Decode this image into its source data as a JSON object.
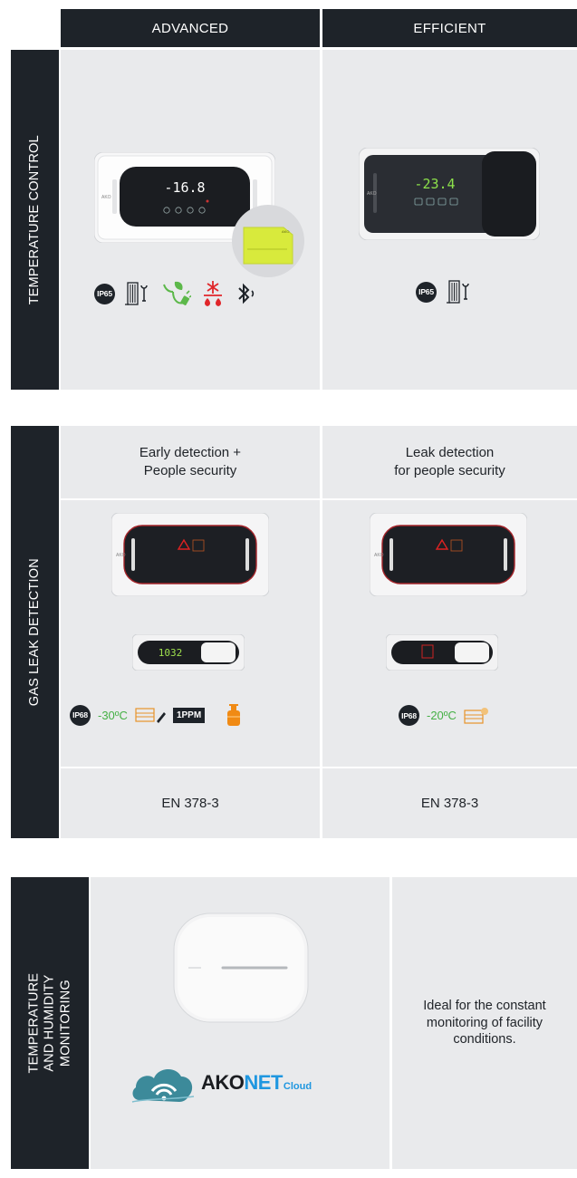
{
  "columns": {
    "advanced": "ADVANCED",
    "efficient": "EFFICIENT"
  },
  "temperature_control": {
    "label": "TEMPERATURE CONTROL",
    "advanced": {
      "display": "-16.8",
      "icons": {
        "rating": "IP65"
      }
    },
    "efficient": {
      "display": "-23.4",
      "icons": {
        "rating": "IP65"
      }
    }
  },
  "gas_leak_detection": {
    "label": "GAS LEAK DETECTION",
    "advanced": {
      "caption": "Early detection +\nPeople security",
      "display": "1032",
      "icons": {
        "rating": "IP68",
        "temperature": "-30ºC",
        "sensitivity": "1PPM"
      },
      "norm": "EN 378-3"
    },
    "efficient": {
      "caption": "Leak detection\nfor people security",
      "icons": {
        "rating": "IP68",
        "temperature": "-20ºC"
      },
      "norm": "EN 378-3"
    }
  },
  "humidity_monitoring": {
    "label": "TEMPERATURE AND HUMIDITY\nMONITORING",
    "brand": {
      "part1": "AKO",
      "part2": "NET",
      "part3": "Cloud"
    },
    "description": "Ideal for the constant\nmonitoring of facility\nconditions."
  },
  "colors": {
    "dark": "#1e2329",
    "cell": "#e9eaec",
    "accent_yellow": "#d8ea3c",
    "accent_green": "#46b046",
    "accent_red": "#e0262a",
    "accent_orange": "#f08a14",
    "cloud_teal": "#3c8a9a",
    "cloud_blue": "#1f97e0"
  }
}
